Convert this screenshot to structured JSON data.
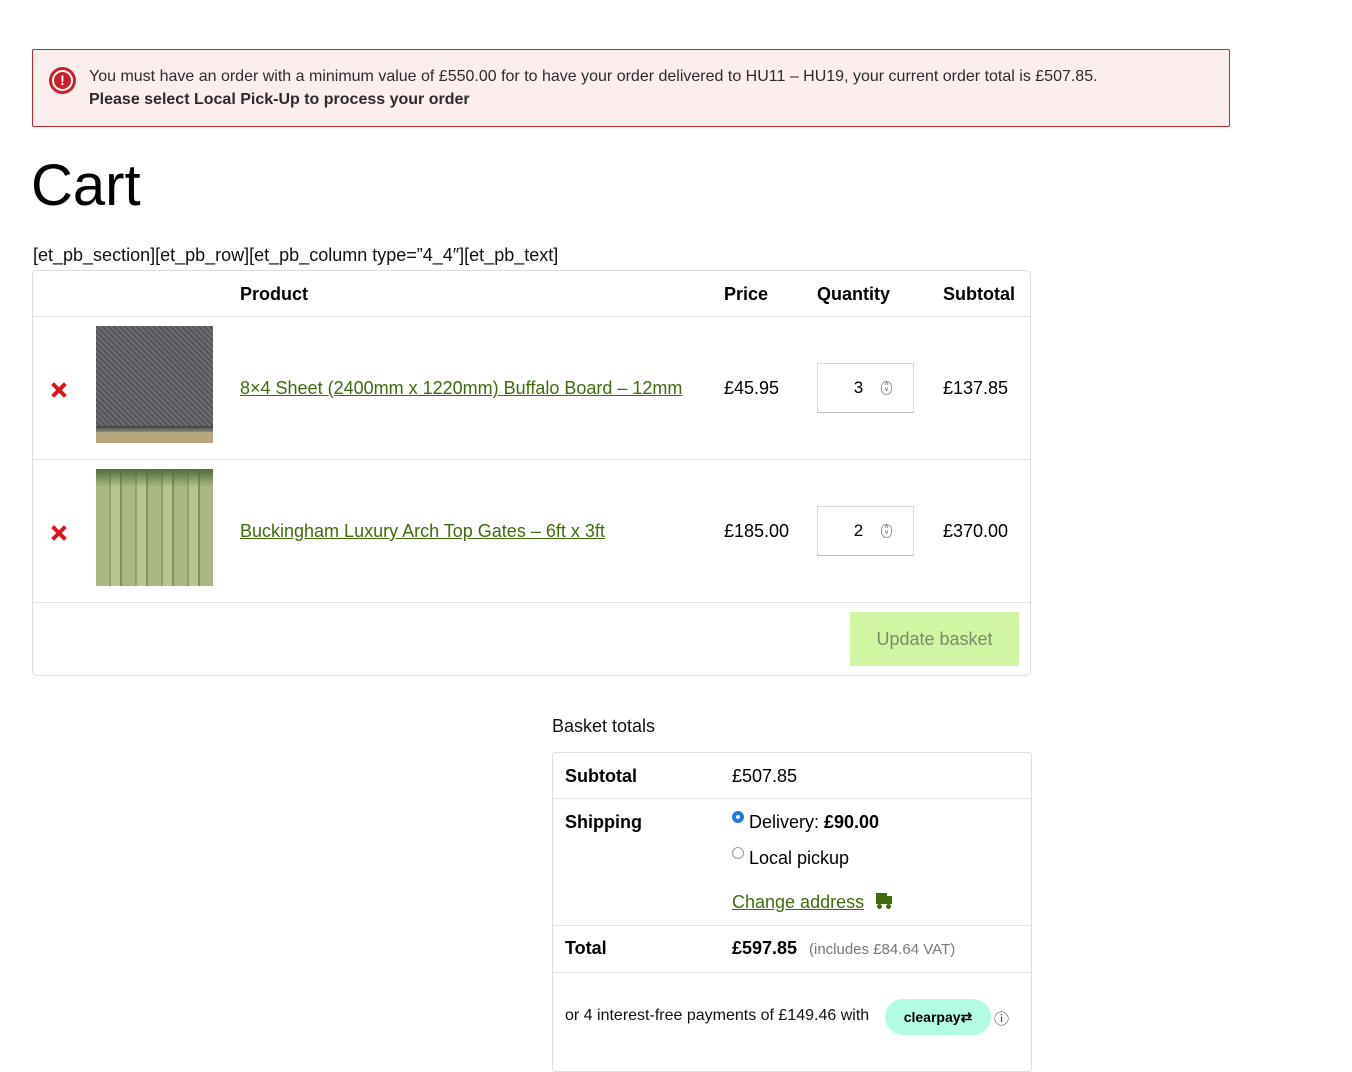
{
  "notice": {
    "icon": "exclamation-circle-icon",
    "icon_glyph": "!",
    "line1": "You must have an order with a minimum value of £550.00 for to have your order delivered to HU11 – HU19, your current order total is £507.85.",
    "line2": "Please select Local Pick-Up to process your order",
    "colors": {
      "border": "#c8252d",
      "background": "#fdeeee",
      "icon": "#cc1f27"
    }
  },
  "page": {
    "title": "Cart",
    "shortcode_text": "[et_pb_section][et_pb_row][et_pb_column type=”4_4″][et_pb_text]"
  },
  "cart": {
    "headers": {
      "product": "Product",
      "price": "Price",
      "quantity": "Quantity",
      "subtotal": "Subtotal"
    },
    "items": [
      {
        "remove_icon": "remove-x-icon",
        "image": "buffalo-board-thumbnail",
        "name": "8×4 Sheet (2400mm x 1220mm) Buffalo Board – 12mm",
        "price": "£45.95",
        "quantity": "3",
        "subtotal": "£137.85"
      },
      {
        "remove_icon": "remove-x-icon",
        "image": "arch-top-gate-thumbnail",
        "name": "Buckingham Luxury Arch Top Gates – 6ft x 3ft",
        "price": "£185.00",
        "quantity": "2",
        "subtotal": "£370.00"
      }
    ],
    "update_button": "Update basket",
    "colors": {
      "link": "#3f6b0c",
      "remove": "#e0131f",
      "update_button_bg": "#d1f6a3"
    }
  },
  "totals": {
    "heading": "Basket totals",
    "subtotal_label": "Subtotal",
    "subtotal_value": "£507.85",
    "shipping_label": "Shipping",
    "shipping_options": [
      {
        "label": "Delivery: ",
        "amount": "£90.00",
        "selected": true
      },
      {
        "label": "Local pickup",
        "selected": false
      }
    ],
    "change_address": "Change address",
    "change_address_icon": "truck-icon",
    "total_label": "Total",
    "total_value": "£597.85",
    "vat_note": "(includes £84.64 VAT)",
    "clearpay_text": "or 4 interest-free payments of £149.46 with",
    "clearpay_badge": "clearpay⇄",
    "clearpay_color": "#b2fce4",
    "info_icon": "ⓘ"
  }
}
